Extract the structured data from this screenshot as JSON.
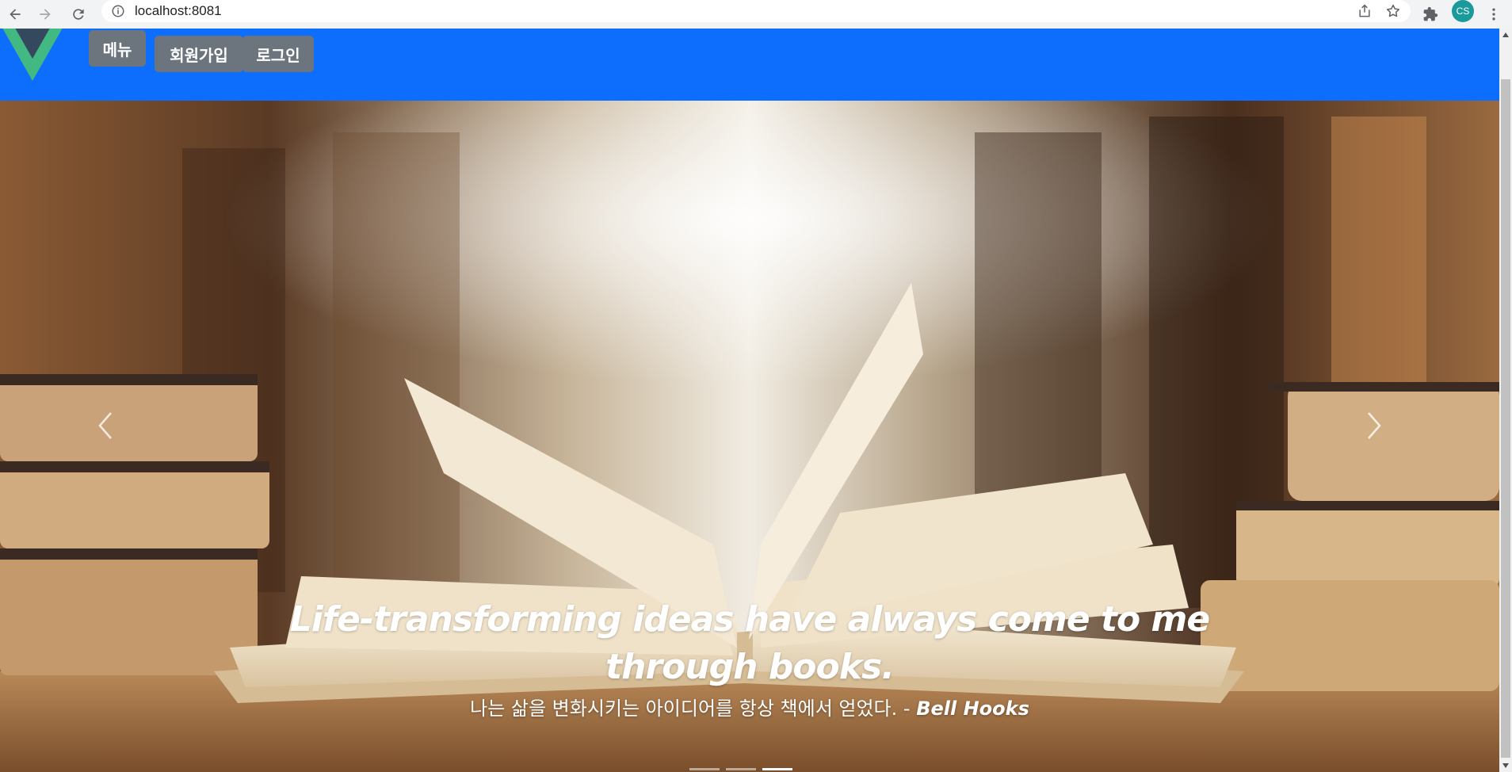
{
  "browser": {
    "url": "localhost:8081",
    "profile_initials": "CS",
    "icons": [
      "back-icon",
      "forward-icon",
      "reload-icon",
      "info-icon",
      "share-icon",
      "star-icon",
      "extensions-icon",
      "kebab-menu-icon"
    ]
  },
  "navbar": {
    "background": "#0d6efd",
    "menu_label": "메뉴",
    "signup_label": "회원가입",
    "login_label": "로그인"
  },
  "carousel": {
    "quote_line1": "Life-transforming ideas have always come to me",
    "quote_line2": "through books.",
    "subtitle": "나는 삶을 변화시키는 아이디어를 항상 책에서 얻었다. - ",
    "author": "Bell Hooks",
    "slide_count": 3,
    "active_slide": 3
  }
}
